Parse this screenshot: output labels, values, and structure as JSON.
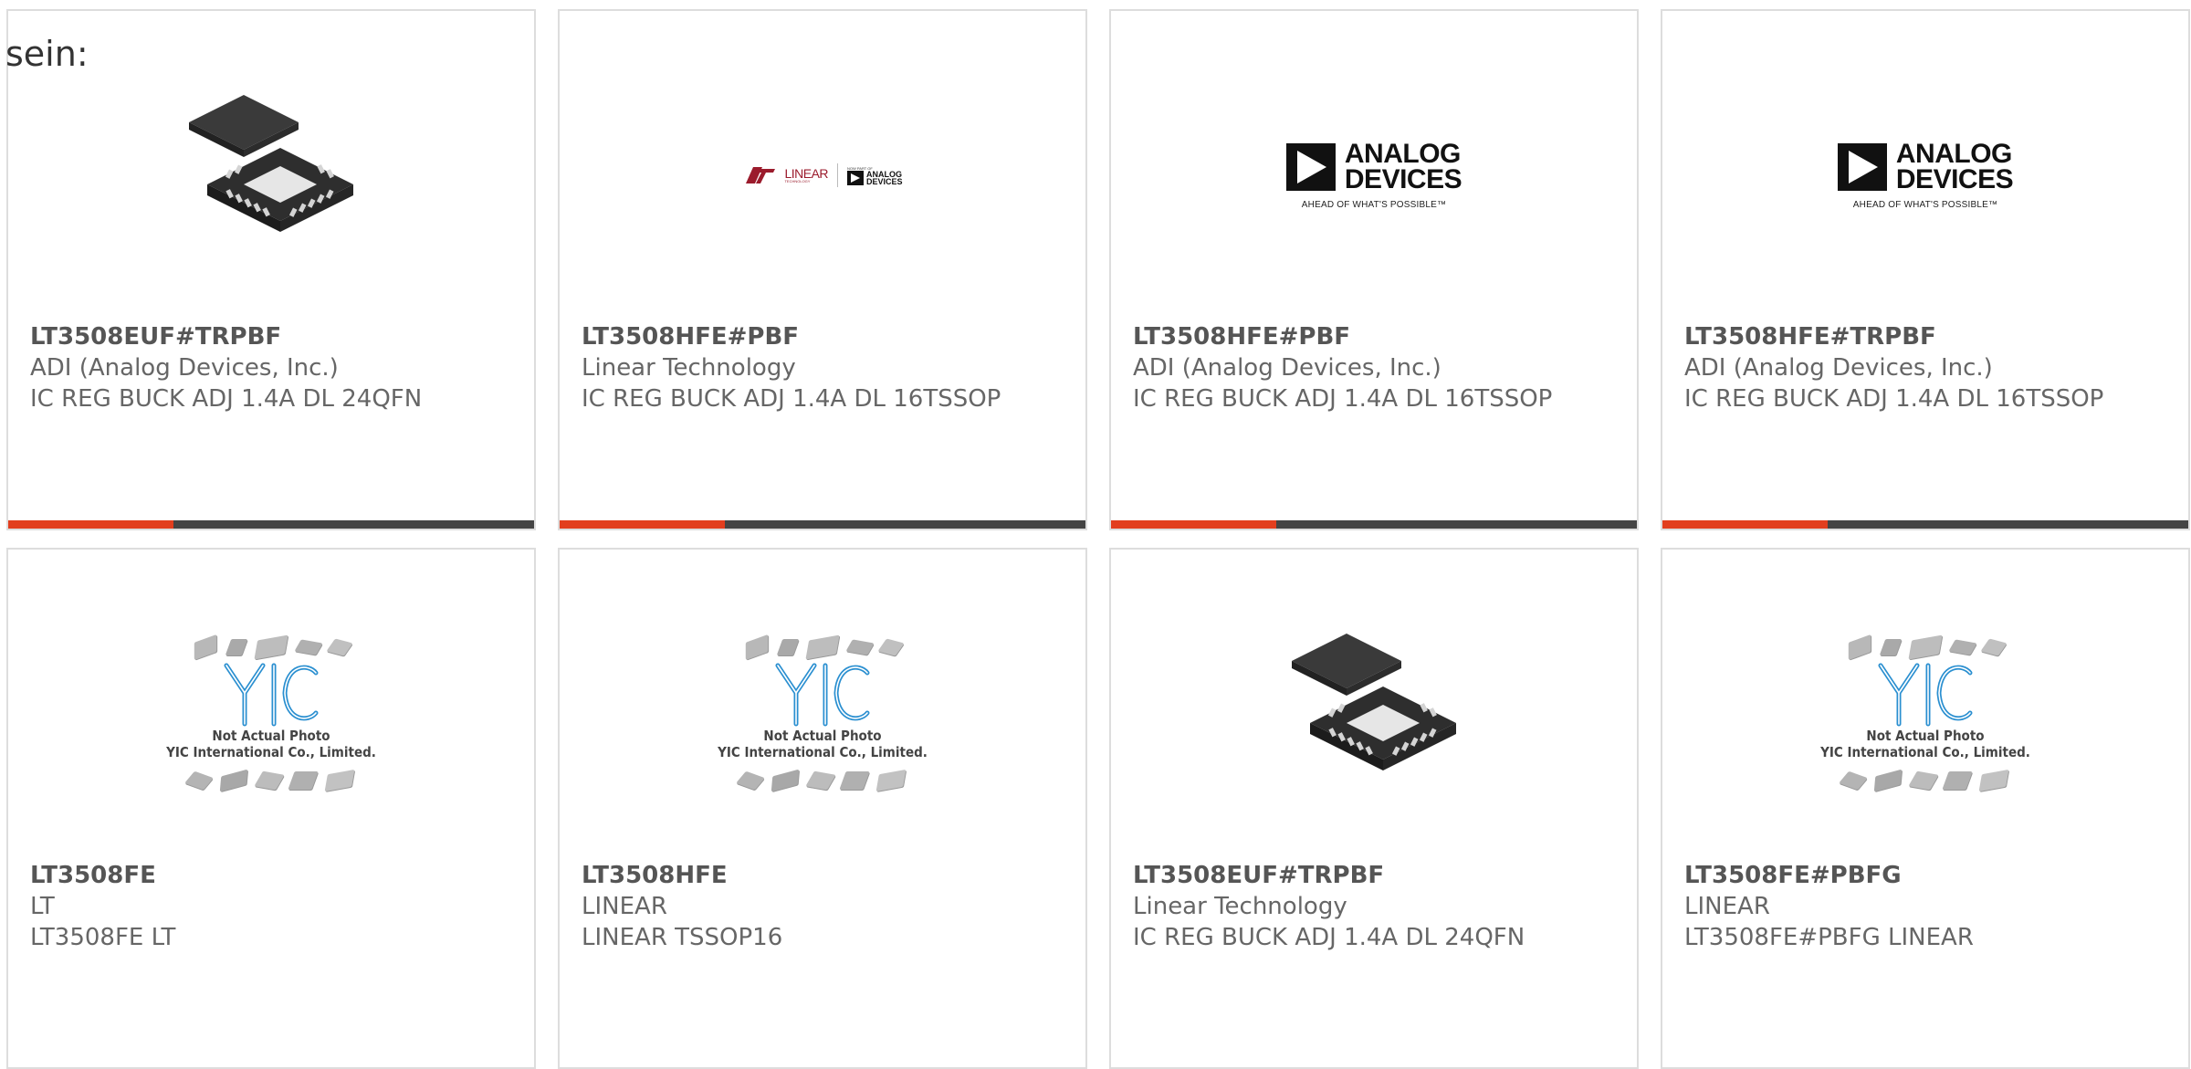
{
  "lead_text": "sein:",
  "colors": {
    "accent": "#e23e1e",
    "bar_dark": "#444444",
    "title": "#555555",
    "text": "#666666"
  },
  "cards": [
    {
      "part": "LT3508EUF#TRPBF",
      "manufacturer": "ADI (Analog Devices, Inc.)",
      "description": "IC REG BUCK ADJ 1.4A DL 24QFN",
      "image": "qfn-chip-photo",
      "has_bar": true
    },
    {
      "part": "LT3508HFE#PBF",
      "manufacturer": "Linear Technology",
      "description": "IC REG BUCK ADJ 1.4A DL 16TSSOP",
      "image": "linear-analog-logo",
      "has_bar": true
    },
    {
      "part": "LT3508HFE#PBF",
      "manufacturer": "ADI (Analog Devices, Inc.)",
      "description": "IC REG BUCK ADJ 1.4A DL 16TSSOP",
      "image": "analog-devices-logo",
      "has_bar": true
    },
    {
      "part": "LT3508HFE#TRPBF",
      "manufacturer": "ADI (Analog Devices, Inc.)",
      "description": "IC REG BUCK ADJ 1.4A DL 16TSSOP",
      "image": "analog-devices-logo",
      "has_bar": true
    },
    {
      "part": "LT3508FE",
      "manufacturer": "LT",
      "description": "LT3508FE LT",
      "image": "yic-placeholder",
      "has_bar": false
    },
    {
      "part": "LT3508HFE",
      "manufacturer": "LINEAR",
      "description": "LINEAR TSSOP16",
      "image": "yic-placeholder",
      "has_bar": false
    },
    {
      "part": "LT3508EUF#TRPBF",
      "manufacturer": "Linear Technology",
      "description": "IC REG BUCK ADJ 1.4A DL 24QFN",
      "image": "qfn-chip-photo",
      "has_bar": false
    },
    {
      "part": "LT3508FE#PBFG",
      "manufacturer": "LINEAR",
      "description": "LT3508FE#PBFG LINEAR",
      "image": "yic-placeholder",
      "has_bar": false
    }
  ],
  "logos": {
    "analog_devices": {
      "line1": "ANALOG",
      "line2": "DEVICES",
      "tagline": "AHEAD OF WHAT'S POSSIBLE™"
    },
    "linear": {
      "brand": "LINEAR",
      "sub": "TECHNOLOGY",
      "now_part_of": "NOW PART OF",
      "ad_line1": "ANALOG",
      "ad_line2": "DEVICES"
    },
    "yic": {
      "mark": "YIC",
      "caption1": "Not Actual Photo",
      "caption2": "YIC International Co., Limited."
    }
  }
}
